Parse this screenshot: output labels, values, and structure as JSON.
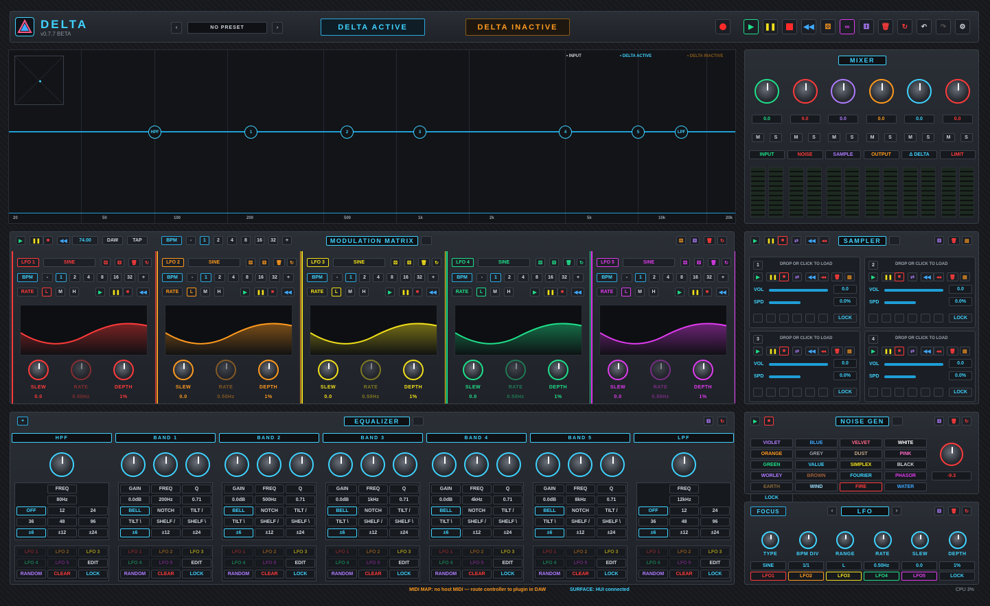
{
  "header": {
    "logo": "DELTA",
    "version": "v0.7.7 BETA",
    "preset": "NO PRESET",
    "active": "DELTA ACTIVE",
    "inactive": "DELTA INACTIVE"
  },
  "analyzer": {
    "legend": [
      "• INPUT",
      "• DELTA ACTIVE",
      "• DELTA INACTIVE"
    ],
    "nodes": [
      "HPF",
      "1",
      "2",
      "3",
      "4",
      "5",
      "LPF"
    ],
    "freqs": [
      "20",
      "50",
      "100",
      "200",
      "500",
      "1k",
      "2k",
      "5k",
      "10k",
      "20k"
    ]
  },
  "mixer": {
    "title": "MIXER",
    "values": [
      "0.0",
      "0.0",
      "0.0",
      "0.0",
      "0.0",
      "0.0"
    ],
    "channels": [
      "INPUT",
      "NOISE",
      "SAMPLE",
      "OUTPUT",
      "Δ DELTA",
      "LIMIT"
    ],
    "ms": [
      "M",
      "S"
    ]
  },
  "mod": {
    "title": "MODULATION MATRIX",
    "bpm": "74.00",
    "daw": "DAW",
    "tap": "TAP",
    "bpm_label": "BPM",
    "divs": [
      "-",
      "1",
      "2",
      "4",
      "8",
      "16",
      "32",
      "+"
    ],
    "lfos": [
      {
        "name": "LFO 1",
        "wave": "SINE",
        "color": "#ff3b3b",
        "slew": "0.0",
        "rate": "0.50Hz",
        "depth": "1%",
        "mode": "L"
      },
      {
        "name": "LFO 2",
        "wave": "SINE",
        "color": "#ff9a1f",
        "slew": "0.0",
        "rate": "0.50Hz",
        "depth": "1%",
        "mode": "L"
      },
      {
        "name": "LFO 3",
        "wave": "SINE",
        "color": "#f2e01b",
        "slew": "0.0",
        "rate": "0.50Hz",
        "depth": "1%",
        "mode": "L"
      },
      {
        "name": "LFO 4",
        "wave": "SINE",
        "color": "#1fe08a",
        "slew": "0.0",
        "rate": "0.50Hz",
        "depth": "1%",
        "mode": "L"
      },
      {
        "name": "LFO 5",
        "wave": "SINE",
        "color": "#e13bf0",
        "slew": "0.0",
        "rate": "0.50Hz",
        "depth": "1%",
        "mode": "L"
      }
    ],
    "rate_label": "RATE",
    "slew_label": "SLEW",
    "depth_label": "DEPTH",
    "m": "M",
    "h": "H"
  },
  "sampler": {
    "title": "SAMPLER",
    "drop": "DROP OR CLICK TO LOAD",
    "vol": "VOL",
    "spd": "SPD",
    "volv": "0.0",
    "spdv": "0.0%",
    "lock": "LOCK"
  },
  "eq": {
    "title": "EQUALIZER",
    "bands": [
      {
        "name": "HPF",
        "freq": "80Hz",
        "type": "hp"
      },
      {
        "name": "BAND 1",
        "gain": "0.0dB",
        "freq": "200Hz",
        "q": "0.71"
      },
      {
        "name": "BAND 2",
        "gain": "0.0dB",
        "freq": "500Hz",
        "q": "0.71"
      },
      {
        "name": "BAND 3",
        "gain": "0.0dB",
        "freq": "1kHz",
        "q": "0.71"
      },
      {
        "name": "BAND 4",
        "gain": "0.0dB",
        "freq": "4kHz",
        "q": "0.71"
      },
      {
        "name": "BAND 5",
        "gain": "0.0dB",
        "freq": "8kHz",
        "q": "0.71"
      },
      {
        "name": "LPF",
        "freq": "12kHz",
        "type": "lp"
      }
    ],
    "labels": {
      "gain": "GAIN",
      "freq": "FREQ",
      "q": "Q",
      "bell": "BELL",
      "notch": "NOTCH",
      "tilt": "TILT /",
      "tiltb": "TILT \\",
      "shelf": "SHELF /",
      "shelfb": "SHELF \\",
      "pm6": "±6",
      "pm12": "±12",
      "pm24": "±24",
      "off": "OFF",
      "s12": "12",
      "s24": "24",
      "s36": "36",
      "s48": "48",
      "s96": "96",
      "lfo1": "LFO 1",
      "lfo2": "LFO 2",
      "lfo3": "LFO 3",
      "lfo4": "LFO 4",
      "lfo5": "LFO 5",
      "edit": "EDIT",
      "random": "RANDOM",
      "clear": "CLEAR",
      "lock": "LOCK"
    }
  },
  "noise": {
    "title": "NOISE GEN",
    "types": [
      "VIOLET",
      "BLUE",
      "VELVET",
      "WHITE",
      "ORANGE",
      "GREY",
      "DUST",
      "PINK",
      "GREEN",
      "VALUE",
      "SIMPLEX",
      "BLACK",
      "WORLEY",
      "BROWN",
      "FOURIER",
      "PHASOR",
      "EARTH",
      "WIND",
      "FIRE",
      "WATER",
      "LOCK"
    ],
    "value": "-9.3"
  },
  "focus": {
    "title": "FOCUS",
    "target": "LFO",
    "knobs": [
      "TYPE",
      "BPM DIV",
      "RANGE",
      "RATE",
      "SLEW",
      "DEPTH"
    ],
    "values": [
      "SINE",
      "1/1",
      "L",
      "0.50Hz",
      "0.0",
      "1%",
      "LOCK"
    ],
    "lfos": [
      "LFO1",
      "LFO2",
      "LFO3",
      "LFO4",
      "LFO5"
    ]
  },
  "status": {
    "midi": "MIDI MAP: no host MIDI — route controller to plugin in DAW",
    "surface": "SURFACE: HUI connected",
    "cpu": "CPU 3%"
  }
}
